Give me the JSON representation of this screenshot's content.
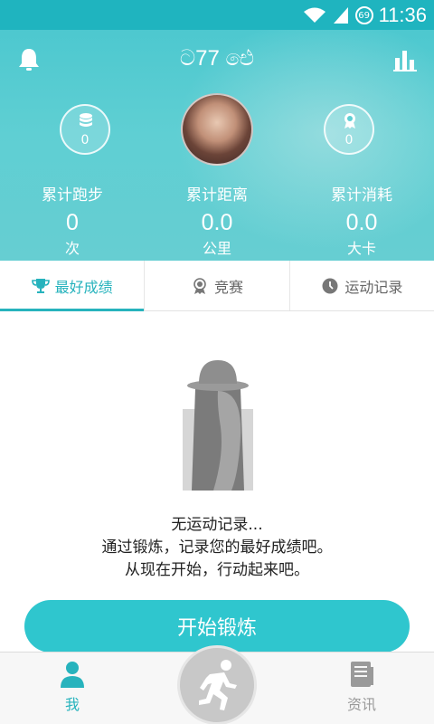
{
  "status_bar": {
    "time": "11:36",
    "battery_level": "69"
  },
  "header": {
    "username": "ට77 ඓ"
  },
  "badges": {
    "left_count": "0",
    "right_count": "0"
  },
  "stats": [
    {
      "label": "累计跑步",
      "value": "0",
      "unit": "次"
    },
    {
      "label": "累计距离",
      "value": "0.0",
      "unit": "公里"
    },
    {
      "label": "累计消耗",
      "value": "0.0",
      "unit": "大卡"
    }
  ],
  "tabs": [
    {
      "label": "最好成绩",
      "icon": "trophy-icon",
      "active": true
    },
    {
      "label": "竞赛",
      "icon": "medal-icon",
      "active": false
    },
    {
      "label": "运动记录",
      "icon": "clock-icon",
      "active": false
    }
  ],
  "empty_state": {
    "line1": "无运动记录...",
    "line2": "通过锻炼，记录您的最好成绩吧。",
    "line3": "从现在开始，行动起来吧。"
  },
  "start_button": {
    "label": "开始锻炼"
  },
  "bottom_nav": {
    "me_label": "我",
    "news_label": "资讯"
  },
  "colors": {
    "accent": "#27b3bd",
    "hero": "#5fcfd3",
    "button": "#2fc6ce"
  }
}
